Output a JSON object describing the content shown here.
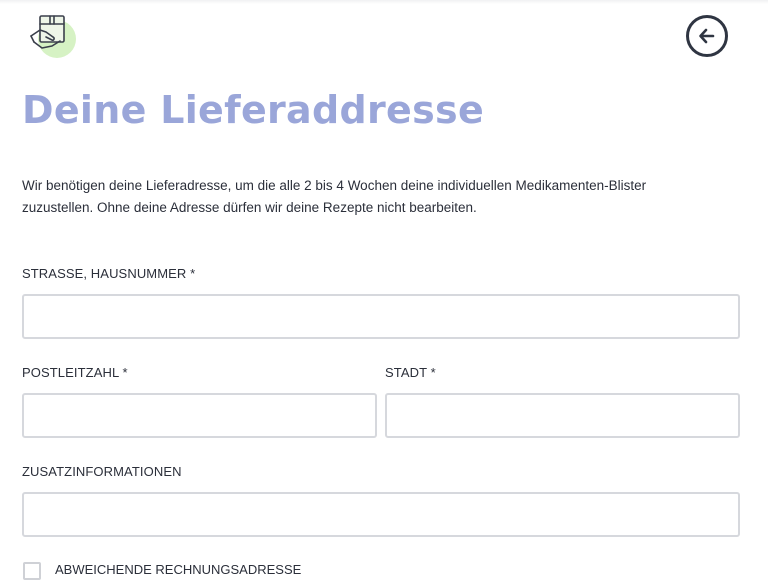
{
  "header": {
    "logo_icon": "box-hand-icon",
    "back_icon": "arrow-left-circle-icon"
  },
  "page": {
    "title": "Deine Lieferaddresse",
    "intro_line1": "Wir benötigen deine Lieferadresse, um die alle 2 bis 4 Wochen deine individuellen Medikamenten-Blister",
    "intro_line2": "zuzustellen. Ohne deine Adresse dürfen wir deine Rezepte nicht bearbeiten."
  },
  "form": {
    "street_label": "STRASSE, HAUSNUMMER *",
    "street_value": "",
    "postal_label": "POSTLEITZAHL *",
    "postal_value": "",
    "city_label": "STADT *",
    "city_value": "",
    "extra_label": "ZUSATZINFORMATIONEN",
    "extra_value": "",
    "billing_checkbox_label": "ABWEICHENDE RECHNUNGSADRESSE",
    "billing_checked": false
  },
  "colors": {
    "title": "#9aa6d9",
    "logo_bg": "#d6f2c4",
    "input_border": "#d6d8dd"
  }
}
